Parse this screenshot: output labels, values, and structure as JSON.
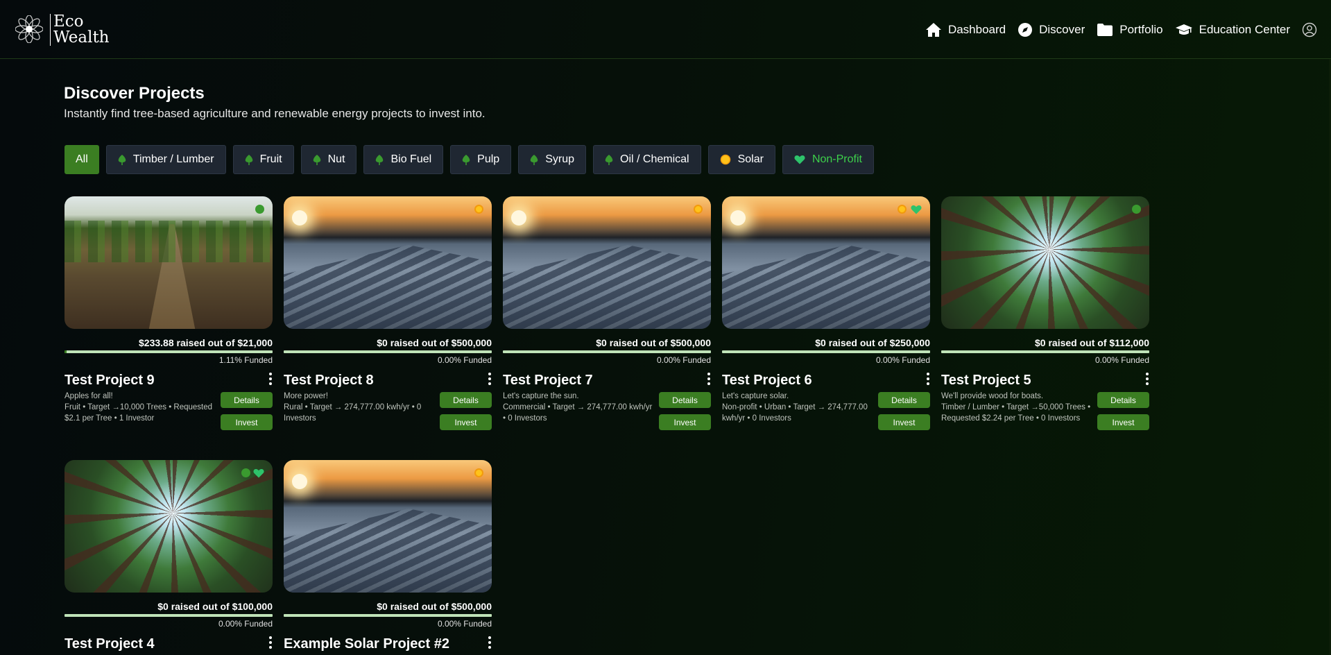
{
  "header": {
    "brand_line1": "Eco",
    "brand_line2": "Wealth",
    "nav": [
      {
        "label": "Dashboard",
        "icon": "home-icon"
      },
      {
        "label": "Discover",
        "icon": "compass-icon"
      },
      {
        "label": "Portfolio",
        "icon": "folder-icon"
      },
      {
        "label": "Education Center",
        "icon": "graduation-cap-icon"
      }
    ],
    "user_icon": "user-circle-icon"
  },
  "page": {
    "title": "Discover Projects",
    "subtitle": "Instantly find tree-based agriculture and renewable energy projects to invest into."
  },
  "filters": [
    {
      "label": "All",
      "icon": "",
      "active": true
    },
    {
      "label": "Timber / Lumber",
      "icon": "tree-icon"
    },
    {
      "label": "Fruit",
      "icon": "tree-icon"
    },
    {
      "label": "Nut",
      "icon": "tree-icon"
    },
    {
      "label": "Bio Fuel",
      "icon": "tree-icon"
    },
    {
      "label": "Pulp",
      "icon": "tree-icon"
    },
    {
      "label": "Syrup",
      "icon": "tree-icon"
    },
    {
      "label": "Oil / Chemical",
      "icon": "tree-icon"
    },
    {
      "label": "Solar",
      "icon": "sun-icon"
    },
    {
      "label": "Non-Profit",
      "icon": "heart-icon"
    }
  ],
  "colors": {
    "accent_green": "#3b7e22",
    "progress_track": "#bfe3b8",
    "nonprofit_text": "#3dd14a",
    "solar_badge": "#ffc21a"
  },
  "actions": {
    "details": "Details",
    "invest": "Invest"
  },
  "projects": [
    {
      "title": "Test Project 9",
      "raised": "$233.88 raised out of $21,000",
      "funded": "1.11% Funded",
      "funded_fraction": 0.0111,
      "desc": "Apples for all!",
      "meta": "Fruit • Target →10,000 Trees • Requested $2.1 per Tree • 1 Investor",
      "image": "crop-field",
      "badges": [
        "tree"
      ]
    },
    {
      "title": "Test Project 8",
      "raised": "$0 raised out of $500,000",
      "funded": "0.00% Funded",
      "funded_fraction": 0,
      "desc": "More power!",
      "meta": "Rural • Target → 274,777.00 kwh/yr • 0 Investors",
      "image": "solar-roof",
      "badges": [
        "sun"
      ]
    },
    {
      "title": "Test Project 7",
      "raised": "$0 raised out of $500,000",
      "funded": "0.00% Funded",
      "funded_fraction": 0,
      "desc": "Let's capture the sun.",
      "meta": "Commercial • Target → 274,777.00 kwh/yr • 0 Investors",
      "image": "solar-roof",
      "badges": [
        "sun"
      ]
    },
    {
      "title": "Test Project 6",
      "raised": "$0 raised out of $250,000",
      "funded": "0.00% Funded",
      "funded_fraction": 0,
      "desc": "Let's capture solar.",
      "meta": "Non-profit • Urban • Target → 274,777.00 kwh/yr • 0 Investors",
      "image": "solar-roof",
      "badges": [
        "sun",
        "heart"
      ]
    },
    {
      "title": "Test Project 5",
      "raised": "$0 raised out of $112,000",
      "funded": "0.00% Funded",
      "funded_fraction": 0,
      "desc": "We'll provide wood for boats.",
      "meta": "Timber / Lumber • Target →50,000 Trees • Requested $2.24 per Tree • 0 Investors",
      "image": "forest-canopy",
      "badges": [
        "tree"
      ]
    },
    {
      "title": "Test Project 4",
      "raised": "$0 raised out of $100,000",
      "funded": "0.00% Funded",
      "funded_fraction": 0,
      "desc": "",
      "meta": "",
      "image": "forest-canopy",
      "badges": [
        "tree",
        "heart"
      ]
    },
    {
      "title": "Example Solar Project #2",
      "raised": "$0 raised out of $500,000",
      "funded": "0.00% Funded",
      "funded_fraction": 0,
      "desc": "",
      "meta": "",
      "image": "solar-roof",
      "badges": [
        "sun"
      ]
    }
  ]
}
